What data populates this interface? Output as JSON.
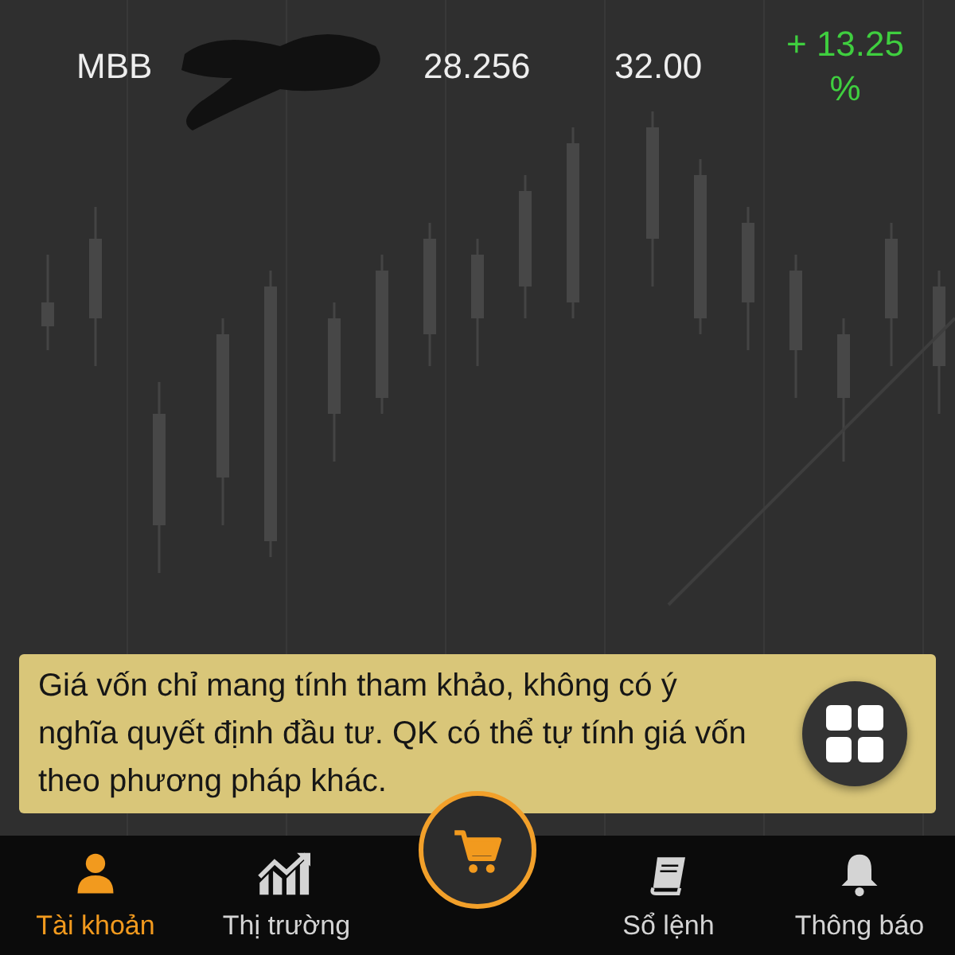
{
  "quote_row": {
    "symbol": "MBB",
    "cost_price": "28.256",
    "market_price": "32.00",
    "change": "+ 13.25 %"
  },
  "notice": {
    "text": "Giá vốn chỉ mang tính tham khảo, không có ý nghĩa quyết định đầu tư. QK có thể tự tính giá vốn theo phương pháp khác."
  },
  "nav": [
    {
      "label": "Tài khoản",
      "selected": true
    },
    {
      "label": "Thị trường",
      "selected": false
    },
    {
      "kind": "order"
    },
    {
      "label": "Sổ lệnh",
      "selected": false
    },
    {
      "label": "Thông báo",
      "selected": false
    }
  ]
}
